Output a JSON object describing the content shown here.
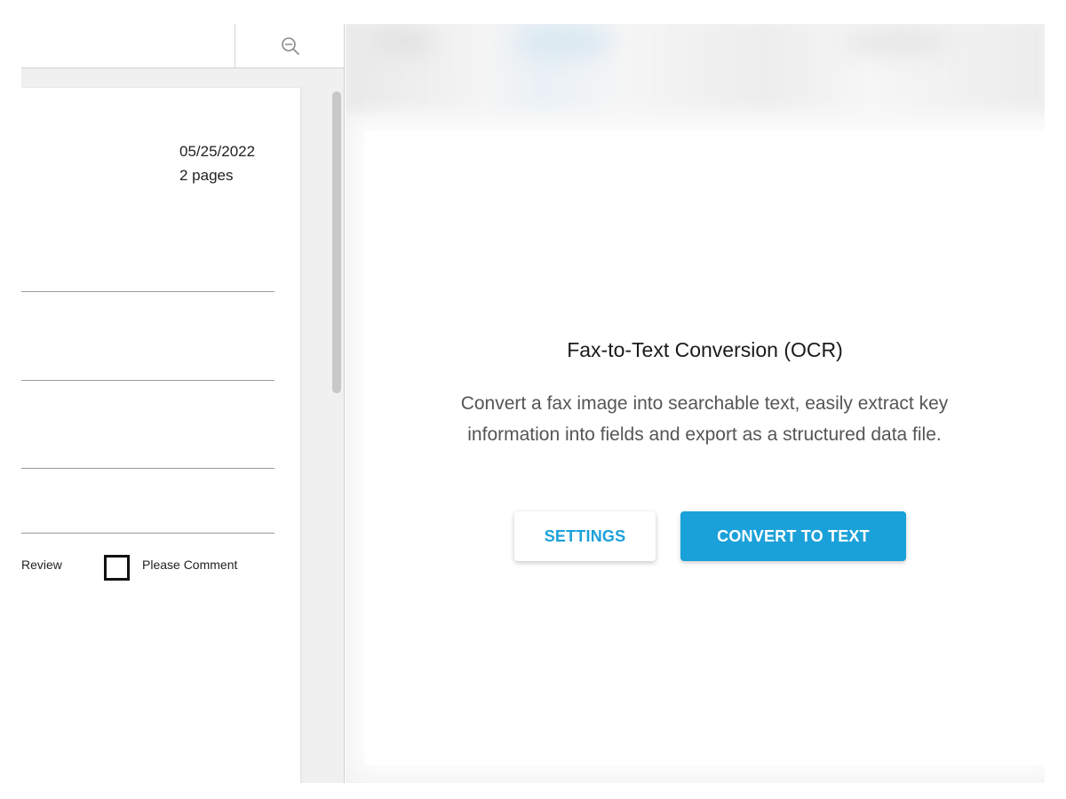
{
  "viewer": {
    "zoom_out_icon": "zoom-out-icon",
    "document": {
      "date": "05/25/2022",
      "pages": "2 pages",
      "checkbox_review_label": "Review",
      "checkbox_comment_label": "Please Comment"
    }
  },
  "ocr_panel": {
    "title": "Fax-to-Text Conversion (OCR)",
    "description": "Convert a fax image into searchable text, easily extract key information into fields and export as a structured data file.",
    "settings_label": "SETTINGS",
    "convert_label": "CONVERT TO TEXT"
  },
  "colors": {
    "accent": "#1ba1d9",
    "title_text": "#1a1a1a",
    "body_text": "#555555"
  }
}
